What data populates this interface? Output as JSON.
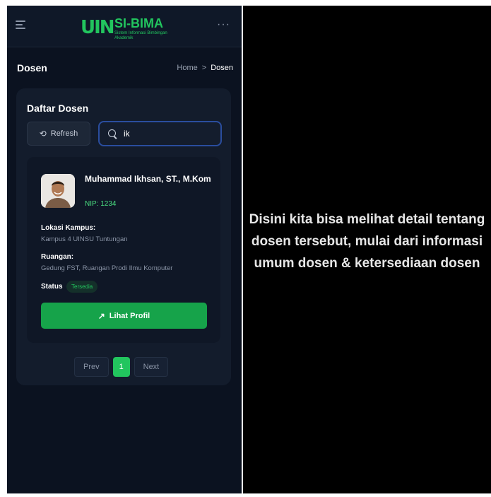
{
  "app": {
    "logo_mark": "UIN",
    "logo_title": "SI-BIMA",
    "logo_subtitle": "Sistem Informasi Bimbingan Akademik"
  },
  "header": {
    "page_title": "Dosen",
    "breadcrumb": {
      "home": "Home",
      "separator": ">",
      "current": "Dosen"
    },
    "menu_icon": "hamburger-icon",
    "more_icon": "ellipsis-icon"
  },
  "list": {
    "title": "Daftar Dosen",
    "refresh_label": "Refresh",
    "search_value": "ik",
    "lecturer": {
      "name": "Muhammad Ikhsan, ST., M.Kom",
      "nip": "NIP: 1234",
      "campus_label": "Lokasi Kampus:",
      "campus_value": "Kampus 4 UINSU Tuntungan",
      "room_label": "Ruangan:",
      "room_value": "Gedung FST, Ruangan Prodi Ilmu Komputer",
      "status_label": "Status",
      "status_value": "Tersedia",
      "profile_button": "Lihat Profil"
    },
    "pagination": {
      "prev": "Prev",
      "current": "1",
      "next": "Next"
    }
  },
  "caption": "Disini kita bisa melihat detail tentang dosen tersebut, mulai dari informasi umum dosen & ketersediaan dosen",
  "colors": {
    "accent": "#22c55e",
    "background": "#0b1220",
    "card": "#131c2c",
    "focus_border": "#2a4d9e"
  }
}
